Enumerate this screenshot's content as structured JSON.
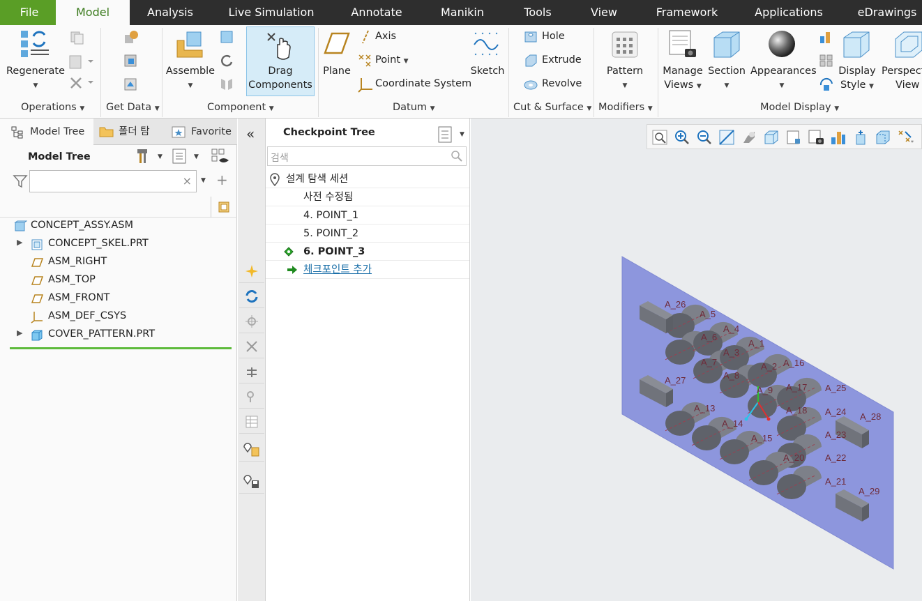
{
  "menu": {
    "tabs": [
      "File",
      "Model",
      "Analysis",
      "Live Simulation",
      "Annotate",
      "Manikin",
      "Tools",
      "View",
      "Framework",
      "Applications",
      "eDrawings"
    ],
    "active": "Model"
  },
  "ribbon": {
    "operations": {
      "regenerate": "Regenerate",
      "label": "Operations"
    },
    "get_data": {
      "label": "Get Data"
    },
    "component": {
      "assemble": "Assemble",
      "drag_line1": "Drag",
      "drag_line2": "Components",
      "label": "Component"
    },
    "datum": {
      "plane": "Plane",
      "axis": "Axis",
      "point": "Point",
      "csys": "Coordinate System",
      "sketch": "Sketch",
      "label": "Datum"
    },
    "cut_surface": {
      "hole": "Hole",
      "extrude": "Extrude",
      "revolve": "Revolve",
      "label": "Cut & Surface"
    },
    "modifiers": {
      "pattern": "Pattern",
      "label": "Modifiers"
    },
    "model_display": {
      "manage_views_1": "Manage",
      "manage_views_2": "Views",
      "section": "Section",
      "appearances": "Appearances",
      "display_style_1": "Display",
      "display_style_2": "Style",
      "perspective_1": "Perspect",
      "perspective_2": "View",
      "label": "Model Display"
    }
  },
  "left_panel": {
    "tabs": [
      "Model Tree",
      "폴더 탐",
      "Favorite"
    ],
    "title": "Model Tree",
    "filter_placeholder": "",
    "tree": [
      {
        "name": "CONCEPT_ASSY.ASM",
        "icon": "assembly-icon",
        "expand": false,
        "indent": 0
      },
      {
        "name": "CONCEPT_SKEL.PRT",
        "icon": "skeleton-icon",
        "expand": true,
        "indent": 1
      },
      {
        "name": "ASM_RIGHT",
        "icon": "datum-plane-icon",
        "expand": false,
        "indent": 1
      },
      {
        "name": "ASM_TOP",
        "icon": "datum-plane-icon",
        "expand": false,
        "indent": 1
      },
      {
        "name": "ASM_FRONT",
        "icon": "datum-plane-icon",
        "expand": false,
        "indent": 1
      },
      {
        "name": "ASM_DEF_CSYS",
        "icon": "csys-icon",
        "expand": false,
        "indent": 1
      },
      {
        "name": "COVER_PATTERN.PRT",
        "icon": "part-icon",
        "expand": true,
        "indent": 1
      }
    ]
  },
  "checkpoint": {
    "title": "Checkpoint Tree",
    "search_placeholder": "검색",
    "session": "설계 탐색 세션",
    "rows": [
      "사전 수정됨",
      "4. POINT_1",
      "5. POINT_2",
      "6. POINT_3"
    ],
    "current": "6. POINT_3",
    "add_link": "체크포인트 추가"
  },
  "graphics": {
    "labels": [
      "A_26",
      "A_5",
      "A_4",
      "A_6",
      "A_1",
      "A_3",
      "A_7",
      "A_2",
      "A_16",
      "A_27",
      "A_8",
      "A_17",
      "A_25",
      "A_9",
      "A_13",
      "A_18",
      "A_24",
      "A_28",
      "A_14",
      "A_23",
      "A_15",
      "A_22",
      "A_20",
      "A_21",
      "A_29"
    ],
    "plane_color": "#8d96dd"
  },
  "colors": {
    "accent": "#5a9e26",
    "menubar": "#2e2e2e",
    "link": "#1a6fa8"
  }
}
